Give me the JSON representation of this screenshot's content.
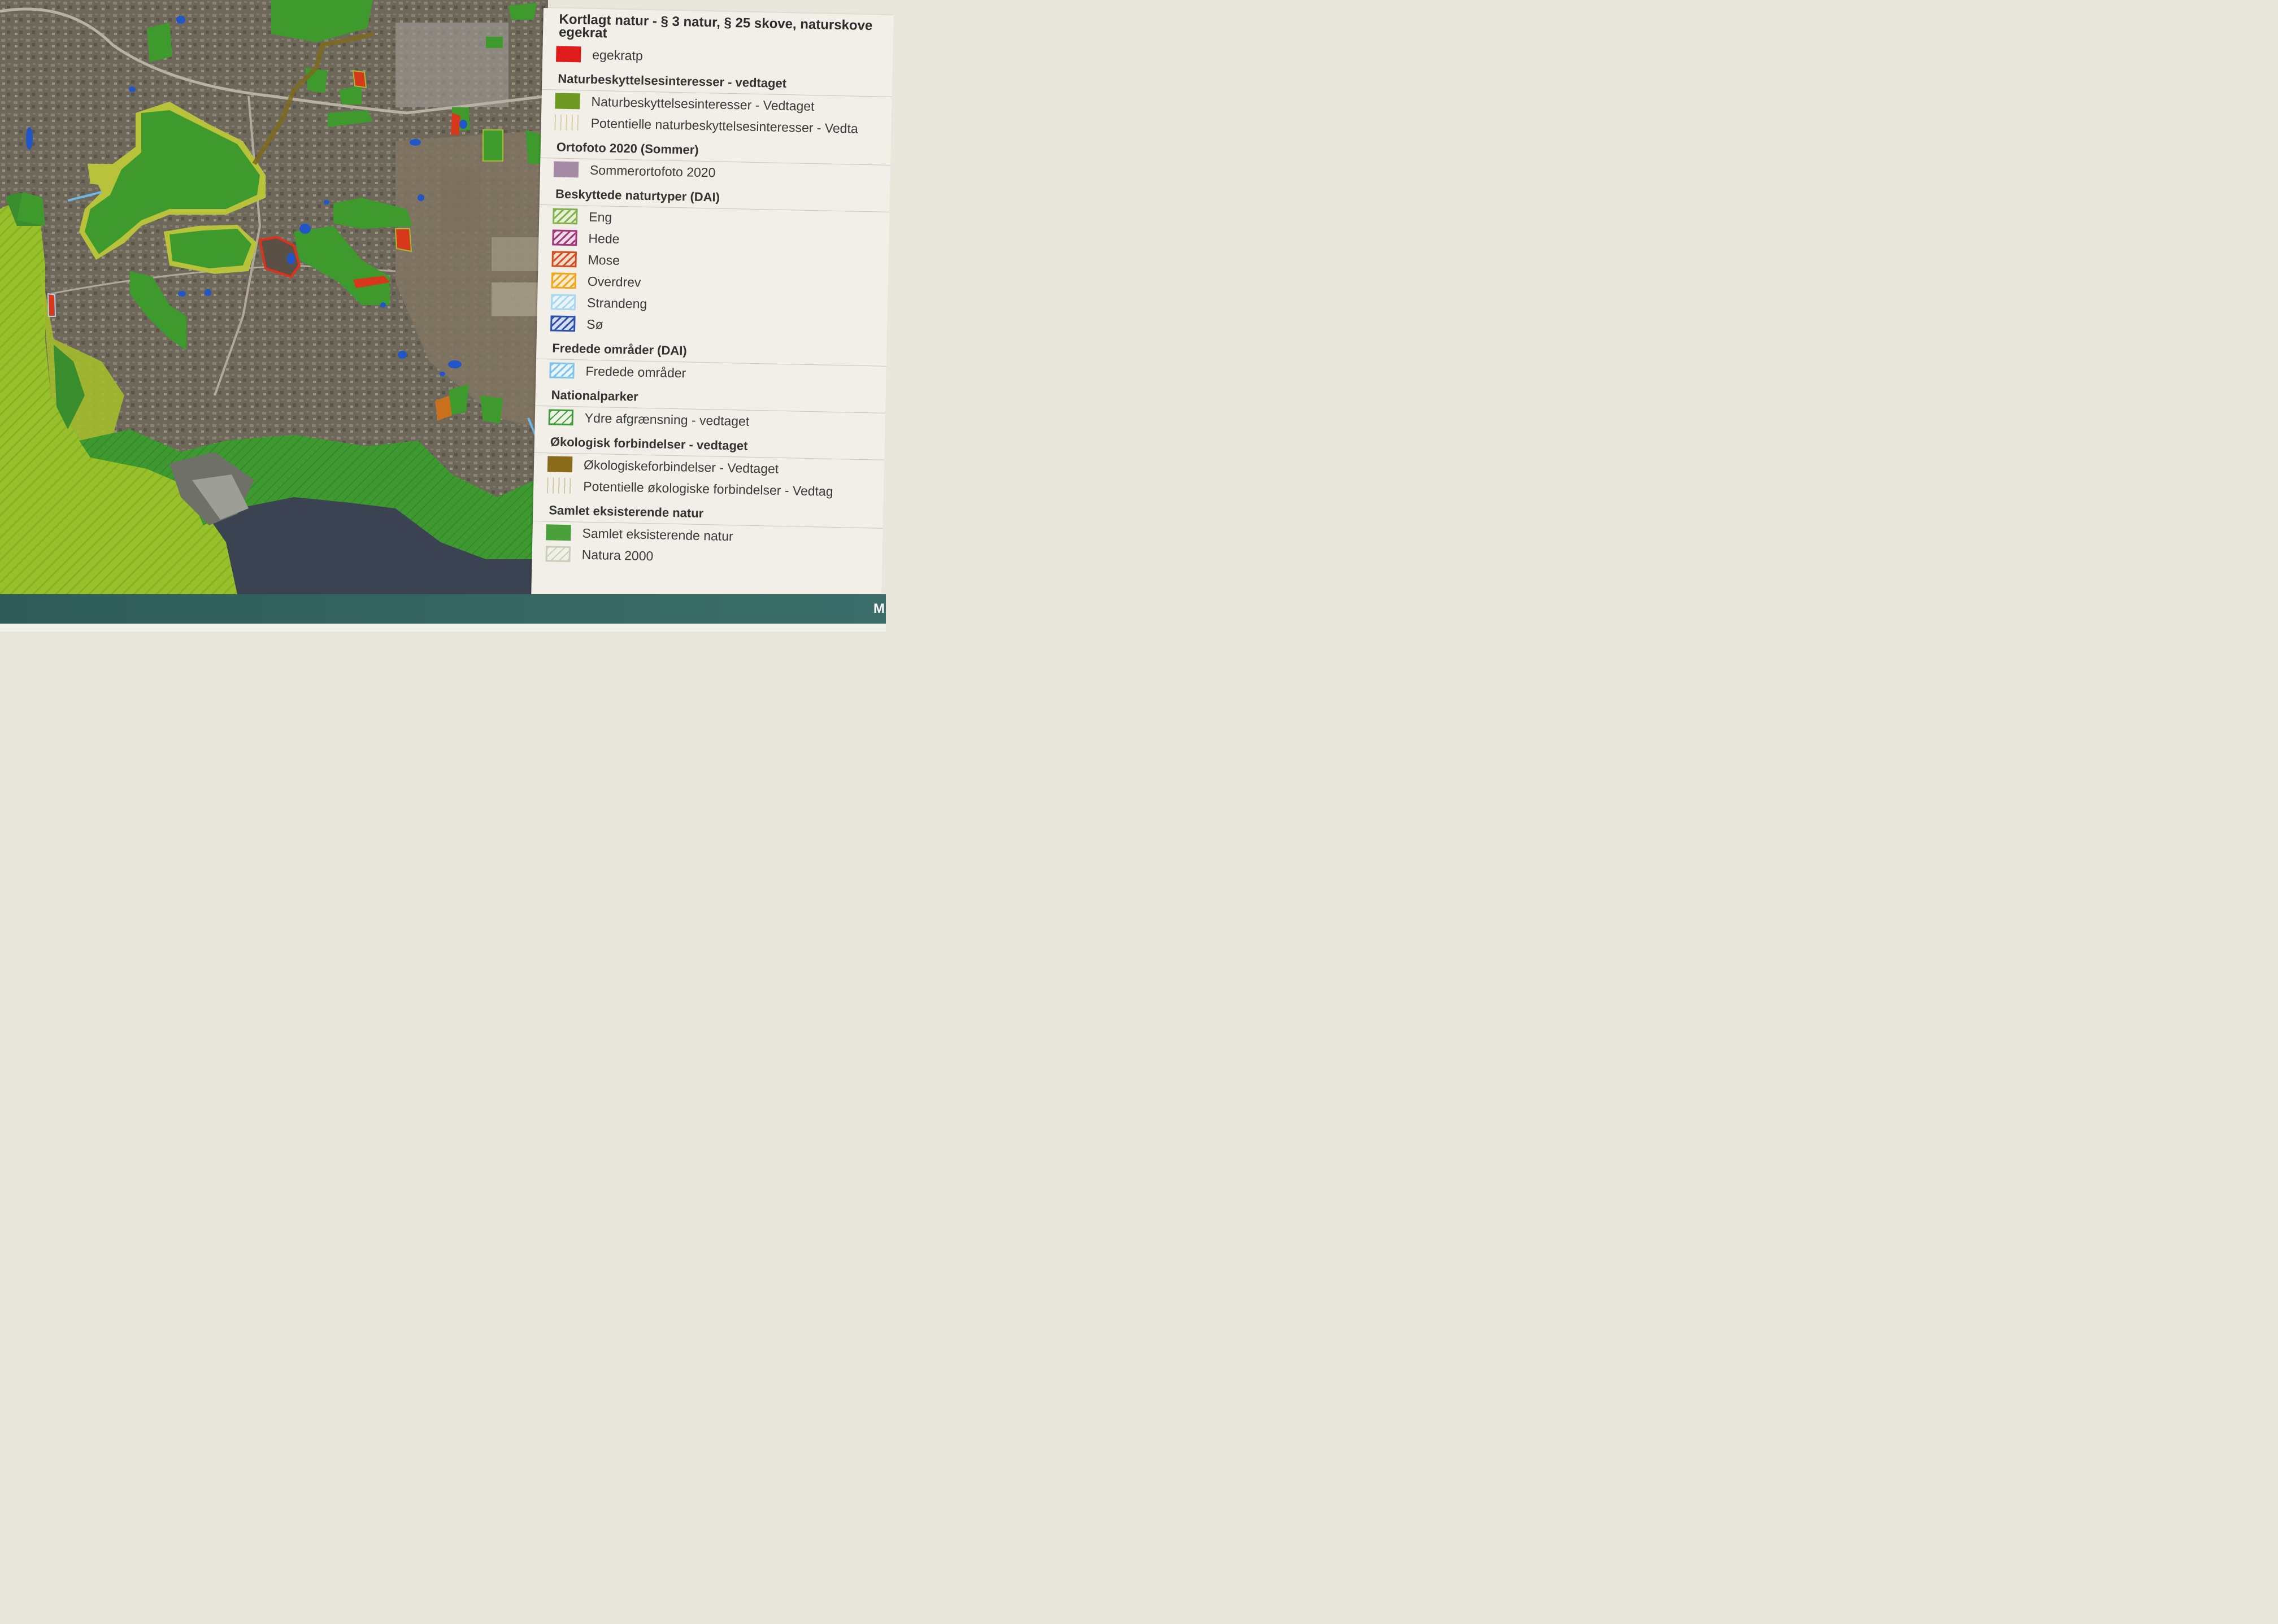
{
  "legend": {
    "title": "Kortlagt natur - § 3 natur, § 25 skove, naturskove egekrat",
    "top_item": {
      "label": "egekratp",
      "color": "#e01b1b"
    },
    "sections": [
      {
        "heading": "Naturbeskyttelsesinteresser - vedtaget",
        "items": [
          {
            "label": "Naturbeskyttelsesinteresser - Vedtaget",
            "swatch": "solid",
            "color": "#6f9a22"
          },
          {
            "label": "Potentielle naturbeskyttelsesinteresser - Vedta",
            "swatch": "vlines-y"
          }
        ]
      },
      {
        "heading": "Ortofoto 2020 (Sommer)",
        "items": [
          {
            "label": "Sommerortofoto 2020",
            "swatch": "solid",
            "color": "#a58aa6"
          }
        ]
      },
      {
        "heading": "Beskyttede naturtyper (DAI)",
        "items": [
          {
            "label": "Eng",
            "swatch": "hatch-eng"
          },
          {
            "label": "Hede",
            "swatch": "hatch-hede"
          },
          {
            "label": "Mose",
            "swatch": "hatch-mose"
          },
          {
            "label": "Overdrev",
            "swatch": "hatch-overdrev"
          },
          {
            "label": "Strandeng",
            "swatch": "hatch-strandeng"
          },
          {
            "label": "Sø",
            "swatch": "hatch-so"
          }
        ]
      },
      {
        "heading": "Fredede områder (DAI)",
        "items": [
          {
            "label": "Fredede områder",
            "swatch": "hatch-fred"
          }
        ]
      },
      {
        "heading": "Nationalparker",
        "items": [
          {
            "label": "Ydre afgrænsning - vedtaget",
            "swatch": "hatch-ydre"
          }
        ]
      },
      {
        "heading": "Økologisk forbindelser - vedtaget",
        "items": [
          {
            "label": "Økologiskeforbindelser - Vedtaget",
            "swatch": "solid",
            "color": "#8a6b1c"
          },
          {
            "label": "Potentielle økologiske forbindelser - Vedtag",
            "swatch": "vlines-b"
          }
        ]
      },
      {
        "heading": "Samlet eksisterende natur",
        "items": [
          {
            "label": "Samlet eksisterende natur",
            "swatch": "solid",
            "color": "#4aa03a"
          },
          {
            "label": "Natura 2000",
            "swatch": "hatch-natura"
          }
        ]
      }
    ]
  },
  "footer": {
    "right_text": "M"
  },
  "colors": {
    "urban_base": "#6c6658",
    "nature_green": "#3f9a2d",
    "yellow_green": "#a7bd2e",
    "coast_green": "#8fbf2a",
    "water": "#3a4150",
    "lake_blue": "#2255c8"
  }
}
